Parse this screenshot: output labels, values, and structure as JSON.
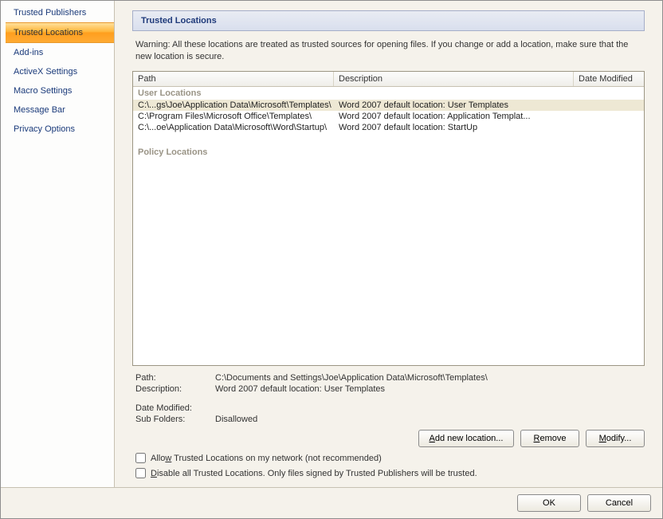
{
  "sidebar": {
    "items": [
      {
        "label": "Trusted Publishers"
      },
      {
        "label": "Trusted Locations"
      },
      {
        "label": "Add-ins"
      },
      {
        "label": "ActiveX Settings"
      },
      {
        "label": "Macro Settings"
      },
      {
        "label": "Message Bar"
      },
      {
        "label": "Privacy Options"
      }
    ],
    "active_index": 1
  },
  "content": {
    "heading": "Trusted Locations",
    "warning": "Warning: All these locations are treated as trusted sources for opening files.  If you change or add a location, make sure that the new location is secure.",
    "columns": {
      "path": "Path",
      "description": "Description",
      "date": "Date Modified"
    },
    "groups": {
      "user": "User Locations",
      "policy": "Policy Locations"
    },
    "rows": [
      {
        "path": "C:\\...gs\\Joe\\Application Data\\Microsoft\\Templates\\",
        "desc": "Word 2007 default location: User Templates",
        "date": ""
      },
      {
        "path": "C:\\Program Files\\Microsoft Office\\Templates\\",
        "desc": "Word 2007 default location: Application Templat...",
        "date": ""
      },
      {
        "path": "C:\\...oe\\Application Data\\Microsoft\\Word\\Startup\\",
        "desc": "Word 2007 default location: StartUp",
        "date": ""
      }
    ],
    "selected_index": 0,
    "details": {
      "path_label": "Path:",
      "path_value": "C:\\Documents and Settings\\Joe\\Application Data\\Microsoft\\Templates\\",
      "desc_label": "Description:",
      "desc_value": "Word 2007 default location: User Templates",
      "date_label": "Date Modified:",
      "date_value": "",
      "subfolders_label": "Sub Folders:",
      "subfolders_value": "Disallowed"
    },
    "buttons": {
      "add": "Add new location...",
      "remove": "Remove",
      "modify": "Modify..."
    },
    "checkboxes": {
      "allow_network": "Allow Trusted Locations on my network (not recommended)",
      "disable_all": "Disable all Trusted Locations. Only files signed by Trusted Publishers will be trusted."
    }
  },
  "dialog_buttons": {
    "ok": "OK",
    "cancel": "Cancel"
  }
}
